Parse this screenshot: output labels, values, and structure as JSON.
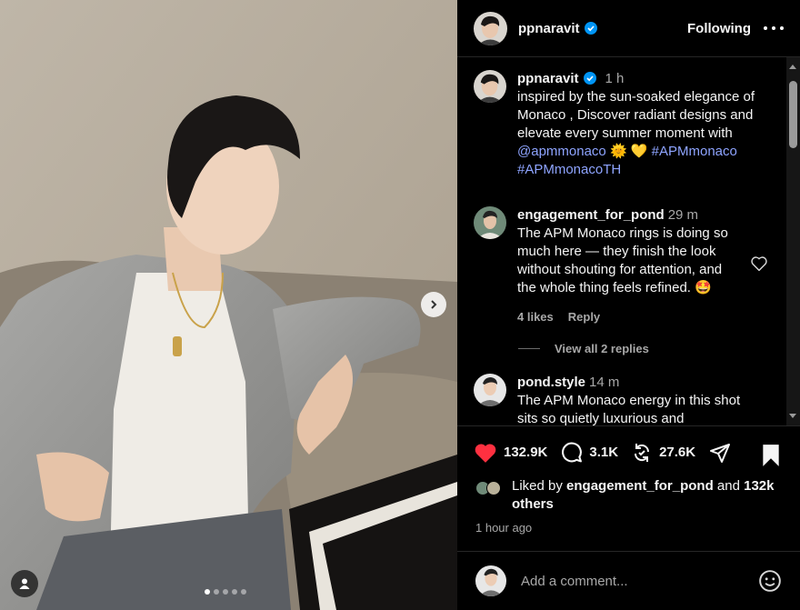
{
  "post": {
    "image_alt": "Man in grey cardigan and white tank top reclining on a sofa",
    "carousel_dots": 5,
    "active_dot": 0
  },
  "header": {
    "username": "ppnaravit",
    "following_label": "Following"
  },
  "caption": {
    "username": "ppnaravit",
    "time": "1 h",
    "text": "inspired by the sun-soaked elegance of Monaco , Discover radiant designs and elevate every summer moment with",
    "mention": "@apmmonaco",
    "emojis": "🌞 💛",
    "hashtag1": "#APMmonaco",
    "hashtag2": "#APMmonacoTH"
  },
  "comments": [
    {
      "username": "engagement_for_pond",
      "time": "29 m",
      "text": "The APM Monaco rings is doing so much here — they finish the look without shouting for attention, and the whole thing feels refined.",
      "emoji": "🤩",
      "likes": "4 likes",
      "reply_label": "Reply",
      "view_replies": "View all 2 replies"
    },
    {
      "username": "pond.style",
      "time": "14 m",
      "text": "The APM Monaco energy in this shot sits so quietly luxurious and"
    }
  ],
  "stats": {
    "likes": "132.9K",
    "comments": "3.1K",
    "reposts": "27.6K"
  },
  "liked_by": {
    "prefix": "Liked by",
    "user": "engagement_for_pond",
    "and": "and",
    "others": "132k others"
  },
  "timestamp": "1 hour ago",
  "add_comment": {
    "placeholder": "Add a comment..."
  },
  "colors": {
    "heart": "#ff3040",
    "link": "#8ea4ff",
    "verified": "#0095f6",
    "background": "#000000"
  }
}
